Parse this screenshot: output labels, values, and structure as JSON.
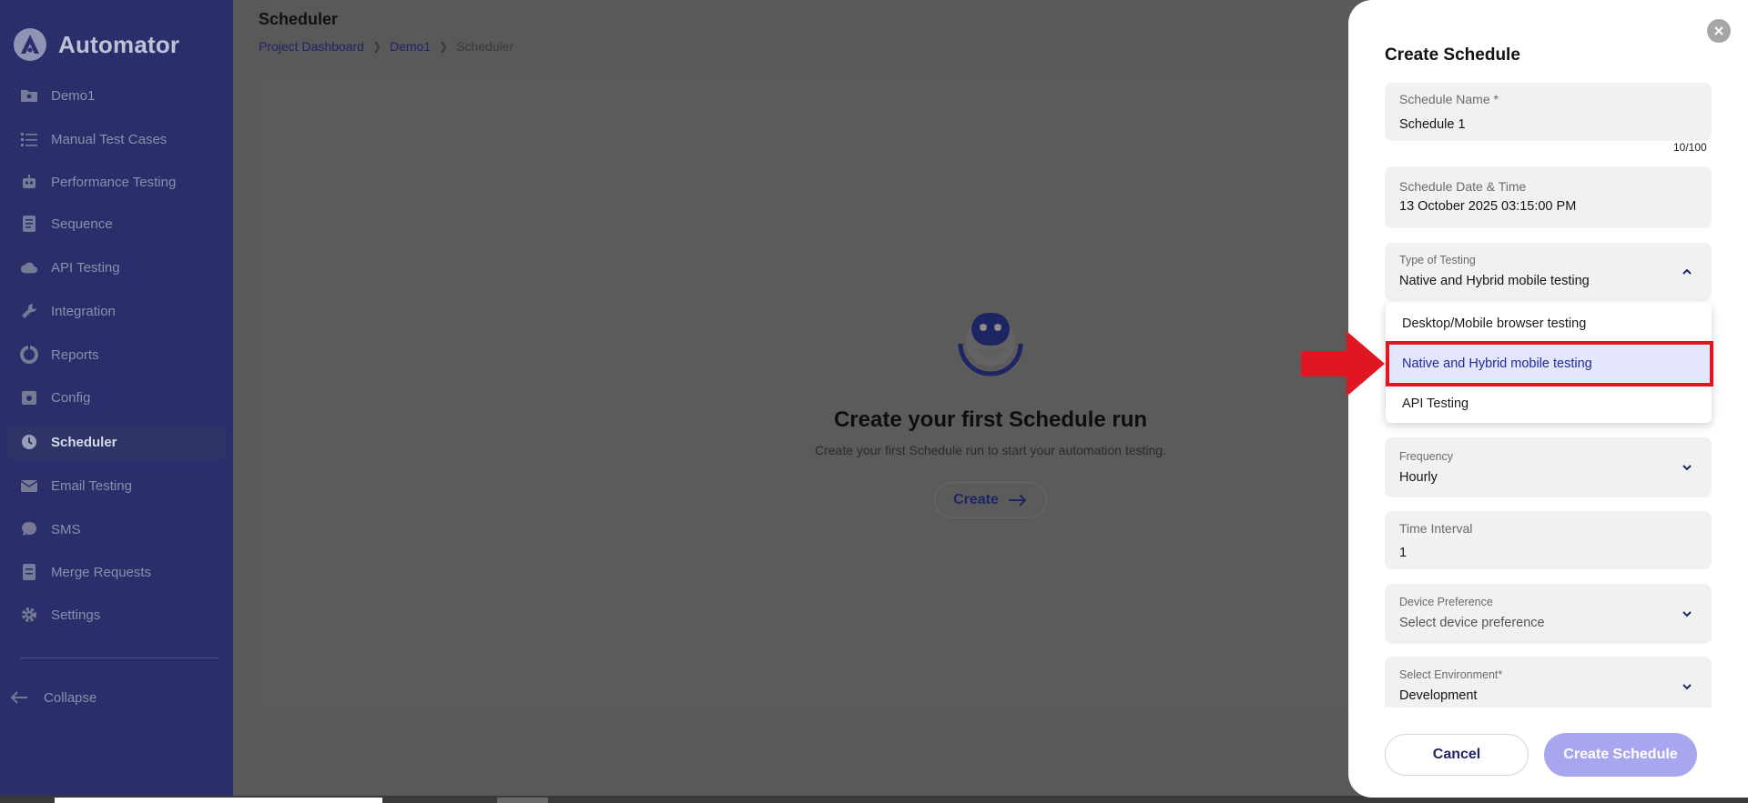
{
  "app": {
    "name": "Automator",
    "brand_color": "#2a2f6c",
    "accent_color": "#1f2aa0"
  },
  "sidebar": {
    "items": [
      {
        "label": "Demo1",
        "icon": "folder-icon"
      },
      {
        "label": "Manual Test Cases",
        "icon": "list-icon"
      },
      {
        "label": "Performance Testing",
        "icon": "robot-icon"
      },
      {
        "label": "Sequence",
        "icon": "document-icon"
      },
      {
        "label": "API Testing",
        "icon": "cloud-icon"
      },
      {
        "label": "Integration",
        "icon": "wrench-icon"
      },
      {
        "label": "Reports",
        "icon": "pie-chart-icon"
      },
      {
        "label": "Config",
        "icon": "config-icon"
      },
      {
        "label": "Scheduler",
        "icon": "clock-icon",
        "active": true
      },
      {
        "label": "Email Testing",
        "icon": "mail-icon"
      },
      {
        "label": "SMS",
        "icon": "chat-icon"
      },
      {
        "label": "Merge Requests",
        "icon": "merge-icon"
      },
      {
        "label": "Settings",
        "icon": "gear-icon"
      }
    ],
    "collapse_label": "Collapse"
  },
  "main": {
    "title": "Scheduler",
    "breadcrumb": [
      "Project Dashboard",
      "Demo1",
      "Scheduler"
    ],
    "empty_state": {
      "title": "Create your first Schedule run",
      "subtitle": "Create your first Schedule run to start your automation testing.",
      "button_label": "Create"
    }
  },
  "drawer": {
    "title": "Create Schedule",
    "schedule_name": {
      "label": "Schedule Name *",
      "value": "Schedule 1",
      "counter": "10/100"
    },
    "schedule_datetime": {
      "label": "Schedule Date & Time",
      "value": "13 October 2025 03:15:00 PM"
    },
    "type_of_testing": {
      "label": "Type of Testing",
      "value": "Native and Hybrid mobile testing",
      "options": [
        "Desktop/Mobile browser testing",
        "Native and Hybrid mobile testing",
        "API Testing"
      ],
      "selected_index": 1
    },
    "frequency": {
      "label": "Frequency",
      "value": "Hourly"
    },
    "time_interval": {
      "label": "Time Interval",
      "value": "1"
    },
    "device_preference": {
      "label": "Device Preference",
      "placeholder": "Select device preference"
    },
    "environment": {
      "label": "Select Environment*",
      "value": "Development"
    },
    "cancel_label": "Cancel",
    "create_label": "Create Schedule"
  },
  "annotation": {
    "highlight_color": "#e01722"
  }
}
